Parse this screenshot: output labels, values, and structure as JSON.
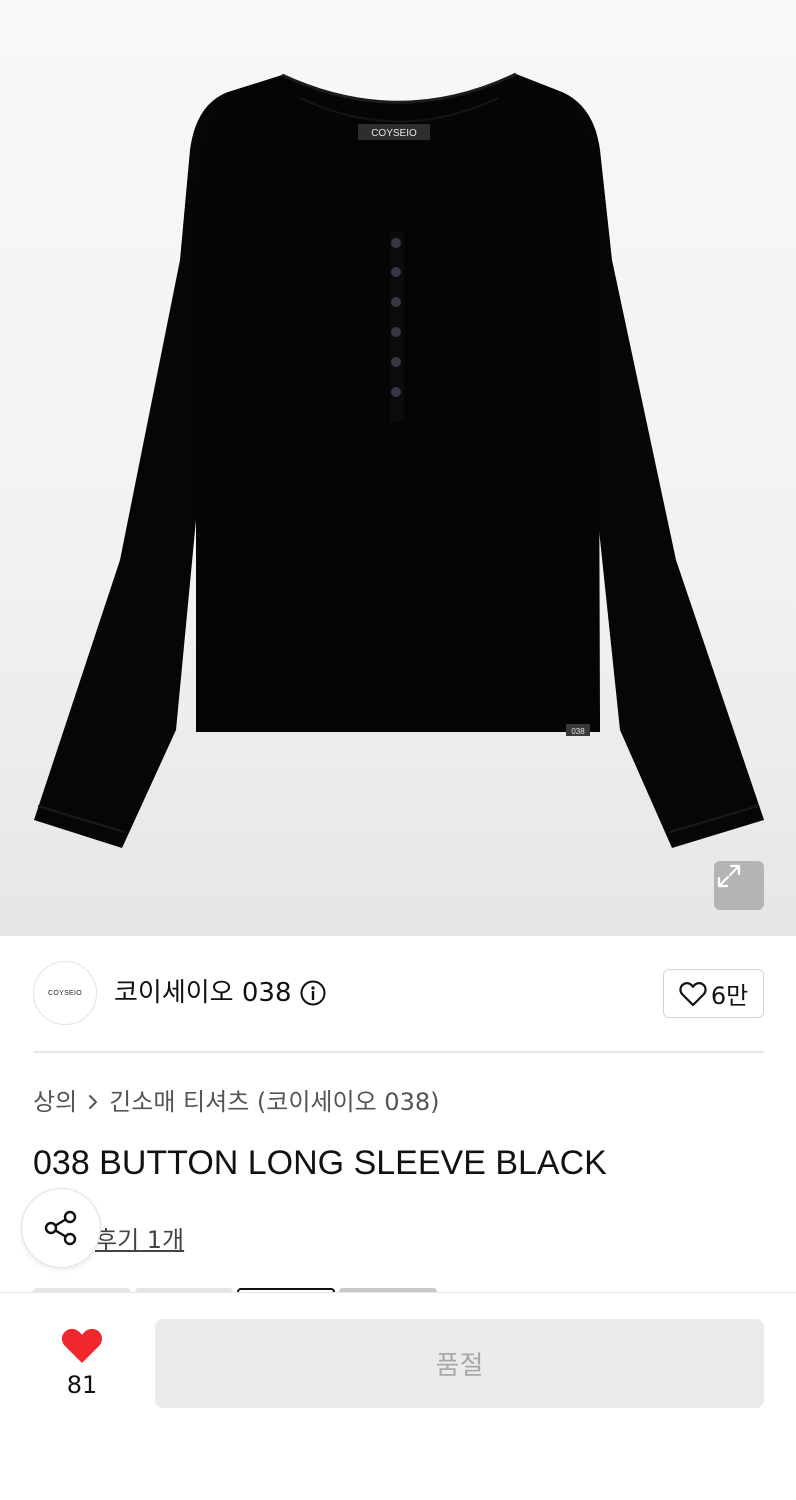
{
  "product_image": {
    "label_text": "COYSEIO",
    "hem_tag_text": "038"
  },
  "brand": {
    "logo_text": "COYSEIO",
    "name": "코이세이오 038",
    "like_count": "6만"
  },
  "breadcrumb": {
    "category": "상의",
    "subcategory": "긴소매 티셔츠 (코이세이오 038)"
  },
  "product": {
    "title": "038 BUTTON LONG SLEEVE BLACK",
    "review_link": "후기 1개"
  },
  "bottom_bar": {
    "like_count": "81",
    "soldout_label": "품절"
  },
  "colors": {
    "heart": "#f0272d",
    "soldout_bg": "#ebebeb",
    "soldout_text": "#a8a8a8",
    "star": "#f5c518"
  }
}
